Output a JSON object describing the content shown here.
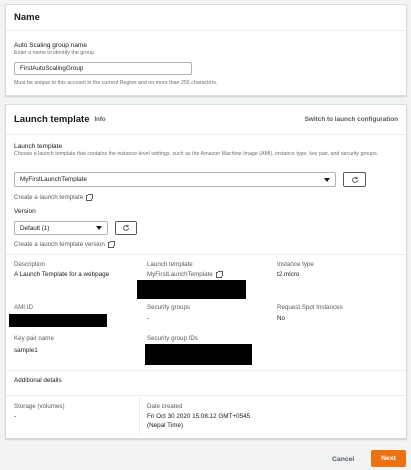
{
  "name_panel": {
    "title": "Name",
    "asg_label": "Auto Scaling group name",
    "asg_hint": "Enter a name to identify the group.",
    "asg_value": "FirstAutoScalingGroup",
    "asg_constraint": "Must be unique to this account in the current Region and no more than 255 characters."
  },
  "lt_panel": {
    "title": "Launch template",
    "info": "Info",
    "switch_link": "Switch to launch configuration",
    "template_label": "Launch template",
    "template_hint": "Choose a launch template that contains the instance-level settings, such as the Amazon Machine Image (AMI), instance type, key pair, and security groups.",
    "template_value": "MyFirstLaunchTemplate",
    "create_template_link": "Create a launch template",
    "version_label": "Version",
    "version_value": "Default (1)",
    "create_version_link": "Create a launch template version",
    "details": {
      "description_label": "Description",
      "description_value": "A Launch Template for a webpage",
      "launch_template_label": "Launch template",
      "launch_template_value": "MyFirstLaunchTemplate",
      "instance_type_label": "Instance type",
      "instance_type_value": "t2.micro",
      "ami_label": "AMI ID",
      "security_groups_label": "Security groups",
      "security_groups_value": "-",
      "spot_label": "Request Spot Instances",
      "spot_value": "No",
      "key_pair_label": "Key pair name",
      "key_pair_value": "sample1",
      "sg_ids_label": "Security group IDs"
    },
    "additional": {
      "title": "Additional details",
      "storage_label": "Storage (volumes)",
      "storage_value": "-",
      "date_label": "Date created",
      "date_value_line1": "Fri Oct 30 2020 15:08:12 GMT+0545",
      "date_value_line2": "(Nepal Time)"
    }
  },
  "footer": {
    "cancel_label": "Cancel",
    "next_label": "Next"
  },
  "colors": {
    "accent": "#ec7211",
    "background": "#f2f3f3"
  }
}
